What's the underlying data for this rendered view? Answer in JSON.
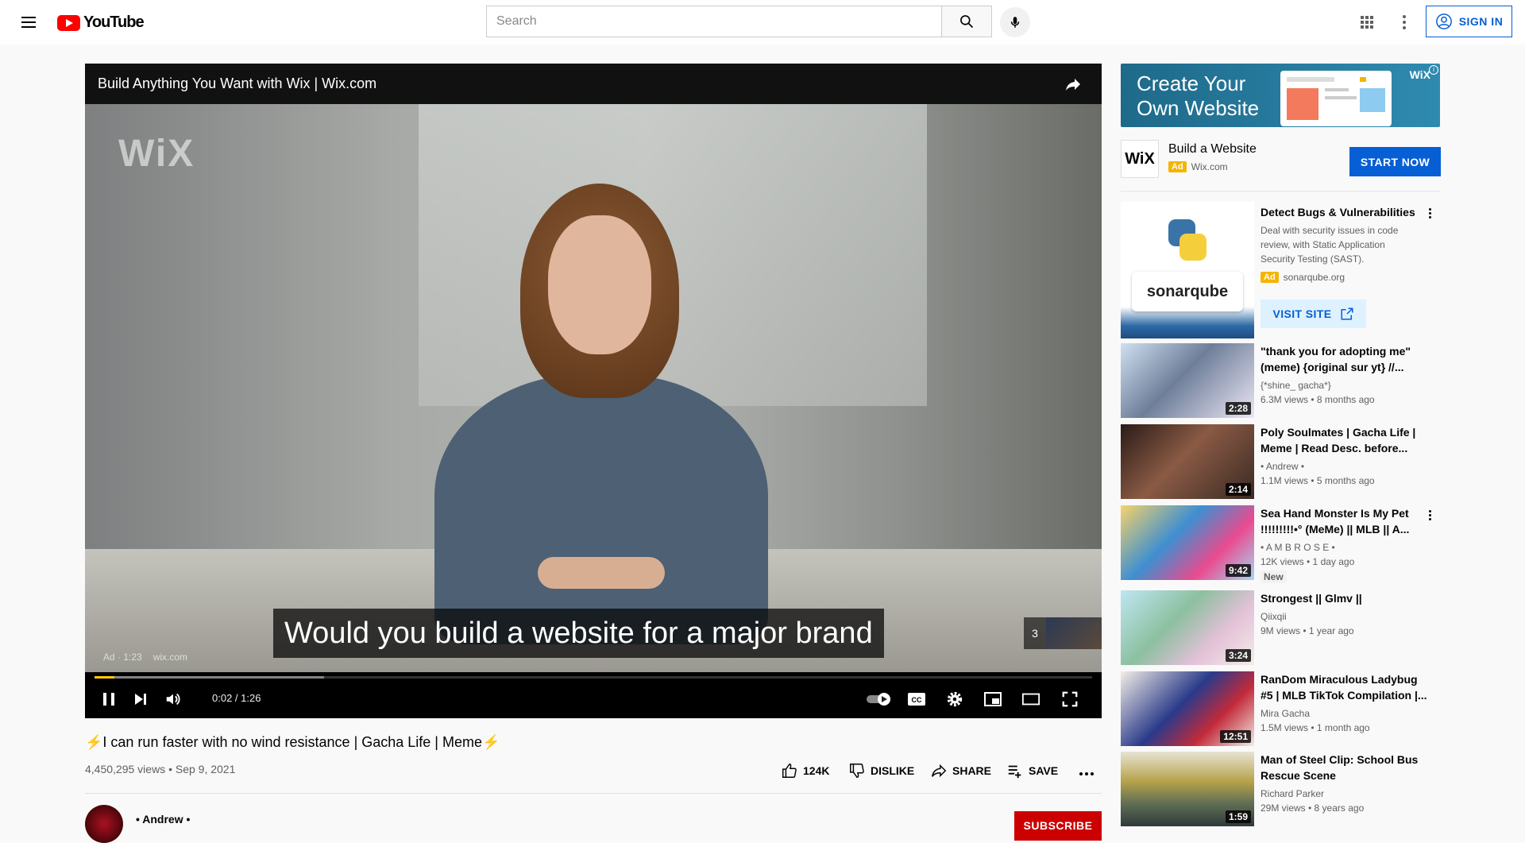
{
  "header": {
    "logo_text": "YouTube",
    "search_placeholder": "Search",
    "signin_label": "SIGN IN"
  },
  "player": {
    "ad_title": "Build Anything You Want with Wix | Wix.com",
    "watermark": "WiX",
    "caption": "Would you build a website for a major brand",
    "skip_count": "3",
    "ad_label": "Ad · 1:23",
    "ad_domain": "wix.com",
    "time": "0:02 / 1:26",
    "progress_fraction": 0.02,
    "buffered_fraction": 0.23,
    "progress_color": "#ffcc00"
  },
  "video": {
    "title": "⚡I can run faster with no wind resistance | Gacha Life | Meme⚡",
    "meta": "4,450,295 views • Sep 9, 2021",
    "likes": "124K",
    "dislike_label": "DISLIKE",
    "share_label": "SHARE",
    "save_label": "SAVE",
    "channel": "• Andrew •",
    "subscribe_label": "SUBSCRIBE"
  },
  "sidebar": {
    "banner": {
      "text_line1": "Create Your",
      "text_line2": "Own Website",
      "logo": "WiX"
    },
    "ad_card": {
      "logo": "WiX",
      "title": "Build a Website",
      "badge": "Ad",
      "domain": "Wix.com",
      "cta": "START NOW"
    },
    "sonar_ad": {
      "logo_text": "sonarqube",
      "title": "Detect Bugs & Vulnerabilities",
      "description": "Deal with security issues in code review, with Static Application Security Testing (SAST).",
      "badge": "Ad",
      "domain": "sonarqube.org",
      "cta": "VISIT SITE"
    },
    "recommendations": [
      {
        "title": "\"thank you for adopting me\" (meme) {original sur yt} //...",
        "channel": "{*shine_ gacha*}",
        "views": "6.3M views • 8 months ago",
        "duration": "2:28",
        "badge": ""
      },
      {
        "title": "Poly Soulmates | Gacha Life | Meme | Read Desc. before...",
        "channel": "• Andrew •",
        "views": "1.1M views • 5 months ago",
        "duration": "2:14",
        "badge": ""
      },
      {
        "title": "Sea Hand Monster Is My Pet !!!!!!!!!•° (MeMe) || MLB || A...",
        "channel": "• A M B R O S E •",
        "views": "12K views • 1 day ago",
        "duration": "9:42",
        "badge": "New"
      },
      {
        "title": "Strongest || Glmv ||",
        "channel": "Qiixqii",
        "views": "9M views • 1 year ago",
        "duration": "3:24",
        "badge": ""
      },
      {
        "title": "RanDom Miraculous Ladybug #5 | MLB TikTok Compilation |...",
        "channel": "Mira Gacha",
        "views": "1.5M views • 1 month ago",
        "duration": "12:51",
        "badge": ""
      },
      {
        "title": "Man of Steel Clip: School Bus Rescue Scene",
        "channel": "Richard Parker",
        "views": "29M views • 8 years ago",
        "duration": "1:59",
        "badge": ""
      }
    ]
  },
  "colors": {
    "brand_red": "#ff0000",
    "link_blue": "#065fd4",
    "subscribe_red": "#cc0000",
    "ad_yellow": "#f5b400"
  }
}
